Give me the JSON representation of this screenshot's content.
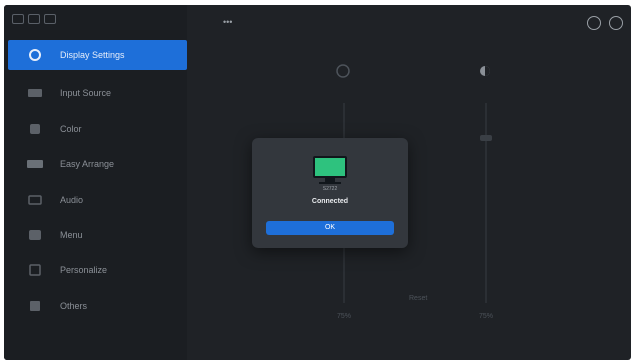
{
  "app": {
    "accent_color": "#1e6fd9",
    "background_color": "#1f2226"
  },
  "header": {
    "title": "•••",
    "icons": [
      "settings-icon",
      "account-icon"
    ]
  },
  "sidebar": {
    "items": [
      {
        "label": "Display Settings",
        "icon": "monitor-icon",
        "active": true
      },
      {
        "label": "Input Source",
        "icon": "input-icon",
        "active": false
      },
      {
        "label": "Color",
        "icon": "color-icon",
        "active": false
      },
      {
        "label": "Easy Arrange",
        "icon": "layout-icon",
        "active": false
      },
      {
        "label": "Audio",
        "icon": "speaker-icon",
        "active": false
      },
      {
        "label": "Menu",
        "icon": "menu-icon",
        "active": false
      },
      {
        "label": "Personalize",
        "icon": "personalize-icon",
        "active": false
      },
      {
        "label": "Others",
        "icon": "others-icon",
        "active": false
      }
    ]
  },
  "main": {
    "sliders": [
      {
        "name": "brightness",
        "icon": "brightness-icon",
        "value_label": "75%"
      },
      {
        "name": "contrast",
        "icon": "contrast-icon",
        "value_label": "75%"
      }
    ],
    "footer_text": "Reset"
  },
  "dialog": {
    "icon": "monitor-icon",
    "icon_color": "#2ec27e",
    "subtitle": "S2722",
    "title": "Connected",
    "button_label": "OK"
  }
}
